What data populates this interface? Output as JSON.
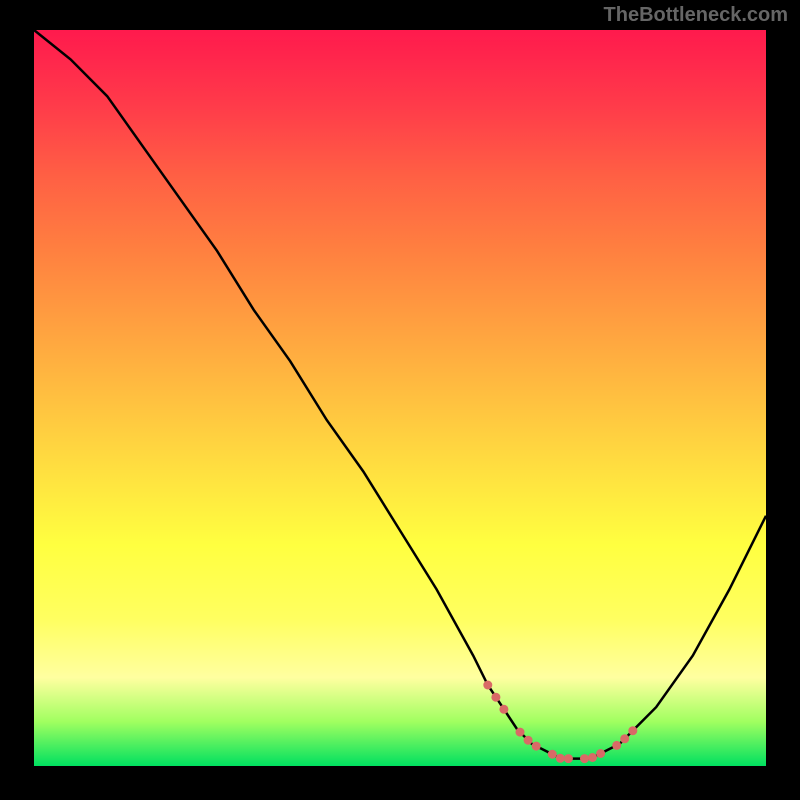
{
  "watermark": "TheBottleneck.com",
  "chart_data": {
    "type": "line",
    "title": "",
    "xlabel": "",
    "ylabel": "",
    "xlim": [
      0,
      100
    ],
    "ylim": [
      0,
      100
    ],
    "series": [
      {
        "name": "bottleneck-curve",
        "x": [
          0,
          5,
          10,
          15,
          20,
          25,
          30,
          35,
          40,
          45,
          50,
          55,
          60,
          62,
          64,
          66,
          68,
          70,
          72,
          74,
          76,
          78,
          80,
          82,
          85,
          90,
          95,
          100
        ],
        "values": [
          100,
          96,
          91,
          84,
          77,
          70,
          62,
          55,
          47,
          40,
          32,
          24,
          15,
          11,
          8,
          5,
          3,
          2,
          1,
          1,
          1,
          2,
          3,
          5,
          8,
          15,
          24,
          34
        ]
      }
    ],
    "dots_region": {
      "x_start": 62,
      "x_end": 82,
      "color": "#d96a66"
    }
  }
}
